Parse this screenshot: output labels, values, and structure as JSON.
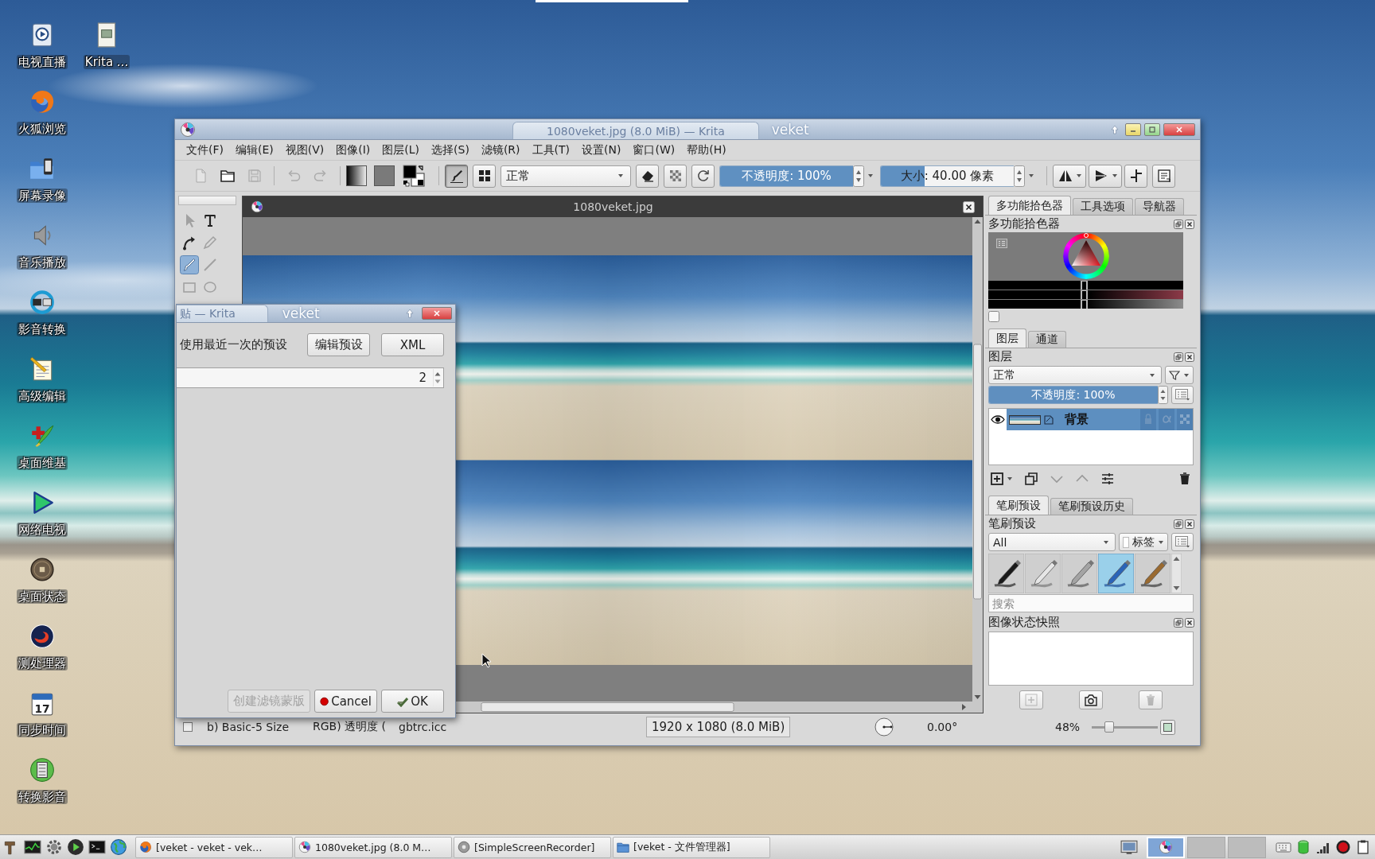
{
  "desktop": {
    "icon_columns": [
      [
        {
          "label": "电视直播",
          "kind": "tv"
        },
        {
          "label": "火狐浏览",
          "kind": "firefox"
        },
        {
          "label": "屏幕录像",
          "kind": "recorder"
        },
        {
          "label": "音乐播放",
          "kind": "speaker"
        },
        {
          "label": "影音转换",
          "kind": "converter"
        },
        {
          "label": "高级编辑",
          "kind": "notepad"
        },
        {
          "label": "桌面维基",
          "kind": "wiki"
        },
        {
          "label": "网络电视",
          "kind": "play"
        },
        {
          "label": "桌面状态",
          "kind": "coin"
        },
        {
          "label": "测处理器",
          "kind": "swirl"
        },
        {
          "label": "同步时间",
          "kind": "calendar",
          "icon_text": "17"
        },
        {
          "label": "转换影音",
          "kind": "film"
        }
      ],
      [
        {
          "label": "Krita ...",
          "kind": "document"
        }
      ]
    ]
  },
  "krita": {
    "title": "1080veket.jpg (8.0 MiB) — Krita",
    "title_tag": "veket",
    "menu": [
      "文件(F)",
      "编辑(E)",
      "视图(V)",
      "图像(I)",
      "图层(L)",
      "选择(S)",
      "滤镜(R)",
      "工具(T)",
      "设置(N)",
      "窗口(W)",
      "帮助(H)"
    ],
    "toolbar": [
      {
        "kind": "new",
        "disabled": true
      },
      {
        "kind": "open",
        "disabled": false
      },
      {
        "kind": "save",
        "disabled": true
      },
      {
        "kind": "separator"
      },
      {
        "kind": "undo",
        "disabled": true
      },
      {
        "kind": "redo",
        "disabled": true
      },
      {
        "kind": "separator"
      },
      {
        "kind": "gradient"
      },
      {
        "kind": "pattern"
      },
      {
        "kind": "colors"
      },
      {
        "kind": "separator"
      },
      {
        "kind": "brush",
        "on": true
      },
      {
        "kind": "presets",
        "on": false
      },
      {
        "kind": "combo",
        "value": "正常"
      },
      {
        "kind": "eraser",
        "on": false
      },
      {
        "kind": "alpha",
        "on": false
      },
      {
        "kind": "reload"
      },
      {
        "kind": "opacity",
        "label": "不透明度: 100%",
        "level": 1
      },
      {
        "kind": "size",
        "label": "大小: 40.00 像素",
        "level": 0.33
      },
      {
        "kind": "separator"
      },
      {
        "kind": "mirror"
      },
      {
        "kind": "flip"
      },
      {
        "kind": "wrap"
      },
      {
        "kind": "workspace"
      }
    ],
    "tools": [
      {
        "kind": "select",
        "selected": false,
        "disabled": true
      },
      {
        "kind": "text",
        "selected": false,
        "disabled": false
      },
      {
        "kind": "curve",
        "selected": false,
        "disabled": false
      },
      {
        "kind": "freehand",
        "selected": false,
        "disabled": true
      },
      {
        "kind": "brush",
        "selected": true,
        "disabled": false
      },
      {
        "kind": "line",
        "selected": false,
        "disabled": true
      },
      {
        "kind": "rect",
        "selected": false,
        "disabled": true
      },
      {
        "kind": "ellipse",
        "selected": false,
        "disabled": true
      }
    ],
    "document": {
      "title": "1080veket.jpg"
    },
    "dock": {
      "color_tabs": [
        {
          "label": "多功能拾色器",
          "selected": true
        },
        {
          "label": "工具选项",
          "selected": false
        },
        {
          "label": "导航器",
          "selected": false
        }
      ],
      "color_title": "多功能拾色器",
      "color_sliders": [
        {
          "level": 0.49
        },
        {
          "level": 0.49
        },
        {
          "level": 0.49
        }
      ],
      "color_checkbox": {
        "checked": false
      },
      "layer_tabs": [
        {
          "label": "图层",
          "selected": true
        },
        {
          "label": "通道",
          "selected": false
        }
      ],
      "layers_title": "图层",
      "layer_blend": "正常",
      "layer_opacity": {
        "label": "不透明度: 100%",
        "level": 1
      },
      "layers": [
        {
          "name": "背景",
          "visible": true,
          "selected": true
        }
      ],
      "layer_buttons": [
        {
          "kind": "add",
          "disabled": false
        },
        {
          "kind": "duplicate",
          "disabled": false
        },
        {
          "kind": "down",
          "disabled": true
        },
        {
          "kind": "up",
          "disabled": true
        },
        {
          "kind": "properties",
          "disabled": false
        },
        {
          "kind": "delete",
          "disabled": false
        }
      ],
      "preset_tabs": [
        {
          "label": "笔刷预设",
          "selected": true
        },
        {
          "label": "笔刷预设历史",
          "selected": false
        }
      ],
      "presets_title": "笔刷预设",
      "preset_filter": "All",
      "tag_button": "标签",
      "presets": [
        {
          "kind": "ink",
          "selected": false
        },
        {
          "kind": "pen",
          "selected": false
        },
        {
          "kind": "marker",
          "selected": false
        },
        {
          "kind": "blue",
          "selected": true
        },
        {
          "kind": "brush",
          "selected": false
        }
      ],
      "search_placeholder": "搜索",
      "snapshots_title": "图像状态快照",
      "snapshot_buttons": [
        {
          "kind": "add",
          "disabled": true
        },
        {
          "kind": "camera",
          "disabled": false
        },
        {
          "kind": "delete",
          "disabled": true
        }
      ]
    },
    "status_bar": {
      "preset": "b) Basic-5 Size",
      "color_space": "RGB) 透明度 (",
      "profile": "gbtrc.icc",
      "dimensions": "1920 x 1080 (8.0 MiB)",
      "rotation": "0.00°",
      "zoom": "48%",
      "zoom_slider": {
        "level": 0.23
      }
    }
  },
  "dialog": {
    "title": "贴 — Krita",
    "title_tag": "veket",
    "preset_label": "使用最近一次的预设",
    "top_buttons": [
      "编辑预设",
      "XML"
    ],
    "spin_value": "2",
    "buttons": [
      {
        "label": "创建滤镜蒙版",
        "kind": "plain",
        "disabled": true
      },
      {
        "label": "Cancel",
        "kind": "cancel",
        "disabled": false
      },
      {
        "label": "OK",
        "kind": "ok",
        "disabled": false
      }
    ]
  },
  "taskbar": {
    "launchers": [
      {
        "kind": "tools"
      },
      {
        "kind": "monitor"
      },
      {
        "kind": "settings"
      },
      {
        "kind": "play"
      },
      {
        "kind": "terminal"
      },
      {
        "kind": "globe"
      }
    ],
    "tasks": [
      {
        "label": "[veket - veket - vek…",
        "kind": "browser"
      },
      {
        "label": "1080veket.jpg (8.0 M…",
        "kind": "krita"
      },
      {
        "label": "[SimpleScreenRecorder]",
        "kind": "recorder"
      },
      {
        "label": "[veket - 文件管理器]",
        "kind": "folder"
      }
    ],
    "applets": [
      {
        "kind": "screenshot"
      }
    ],
    "pager": [
      {
        "selected": true,
        "windows": [
          {
            "kind": "krita"
          }
        ]
      },
      {
        "selected": false
      },
      {
        "selected": false
      }
    ],
    "tray": [
      {
        "kind": "keyboard"
      },
      {
        "kind": "database"
      },
      {
        "kind": "signal"
      },
      {
        "kind": "record"
      },
      {
        "kind": "clipboard"
      }
    ]
  }
}
